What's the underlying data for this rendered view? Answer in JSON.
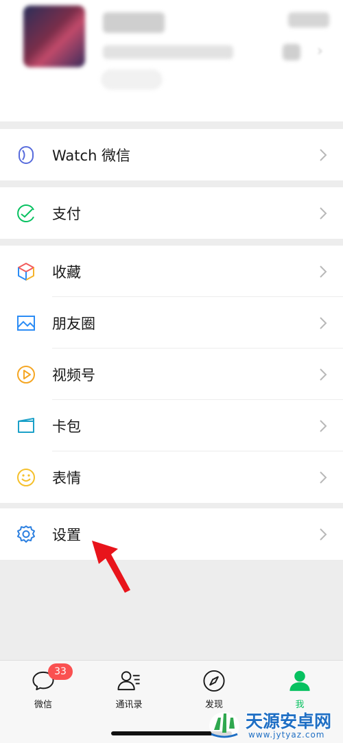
{
  "menu": {
    "group1": [
      {
        "label": "Watch 微信",
        "icon": "watch-icon"
      }
    ],
    "group2": [
      {
        "label": "支付",
        "icon": "pay-icon"
      }
    ],
    "group3": [
      {
        "label": "收藏",
        "icon": "favorites-icon"
      },
      {
        "label": "朋友圈",
        "icon": "moments-icon"
      },
      {
        "label": "视频号",
        "icon": "channels-icon"
      },
      {
        "label": "卡包",
        "icon": "card-wallet-icon"
      },
      {
        "label": "表情",
        "icon": "stickers-icon"
      }
    ],
    "group4": [
      {
        "label": "设置",
        "icon": "settings-icon"
      }
    ]
  },
  "tabbar": {
    "chats": {
      "label": "微信",
      "badge": "33"
    },
    "contacts": {
      "label": "通讯录"
    },
    "discover": {
      "label": "发现"
    },
    "me": {
      "label": "我"
    }
  },
  "watermark": {
    "title": "天源安卓网",
    "url": "www.jytyaz.com"
  },
  "colors": {
    "accent_green": "#07c160",
    "badge_red": "#fa5151",
    "arrow_red": "#e8141b",
    "background": "#ededed"
  }
}
